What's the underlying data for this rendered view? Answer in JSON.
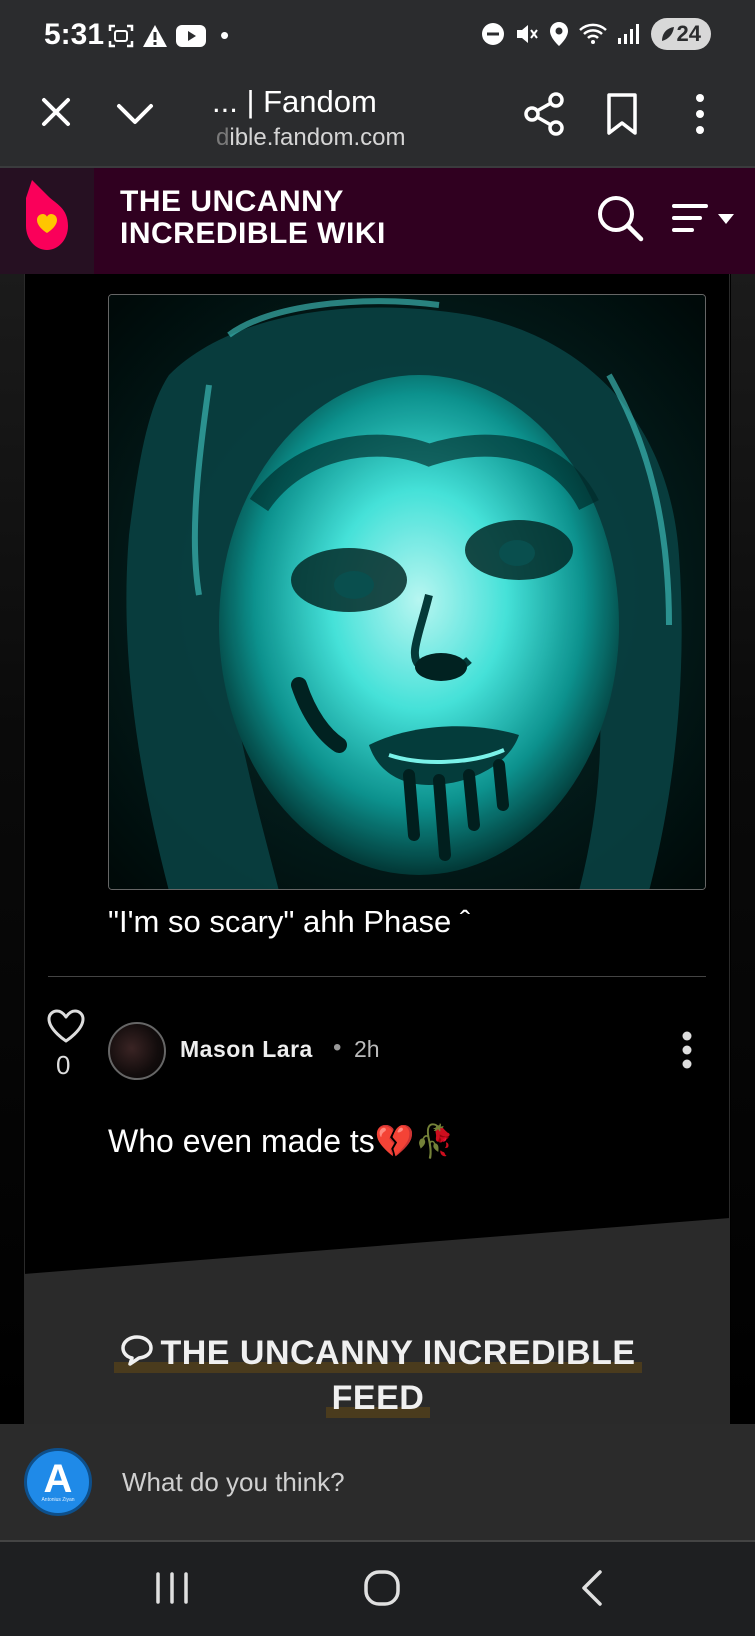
{
  "status_bar": {
    "time": "5:31",
    "battery": "24",
    "notification_dot": "•"
  },
  "browser": {
    "title": "... | Fandom",
    "url_faded": "d",
    "url_rest": "ible.fandom.com"
  },
  "header": {
    "wiki_title_line1": "THE UNCANNY",
    "wiki_title_line2": "INCREDIBLE WIKI",
    "brand_color": "#300020",
    "logo_color": "#fa005a"
  },
  "post": {
    "image_alt": "cyan-tinted portrait",
    "caption": "\"I'm so scary\" ahh Phase ˆ"
  },
  "reply": {
    "like_count": "0",
    "author": "Mason Lara",
    "separator": "•",
    "time_ago": "2h",
    "text": "Who even made ts💔🥀"
  },
  "feed": {
    "title_line1": "THE UNCANNY INCREDIBLE",
    "title_line2": "FEED"
  },
  "comment_box": {
    "avatar_letter": "A",
    "avatar_sub": "Antonius Ziyan",
    "placeholder": "What do you think?"
  },
  "icons": {
    "close": "close-icon",
    "chevron": "chevron-down-icon",
    "share": "share-icon",
    "bookmark": "bookmark-icon",
    "more": "more-vertical-icon",
    "search": "search-icon",
    "menu": "menu-icon",
    "heart": "heart-icon",
    "nav_recent": "recent-apps-icon",
    "nav_home": "home-icon",
    "nav_back": "back-icon"
  }
}
